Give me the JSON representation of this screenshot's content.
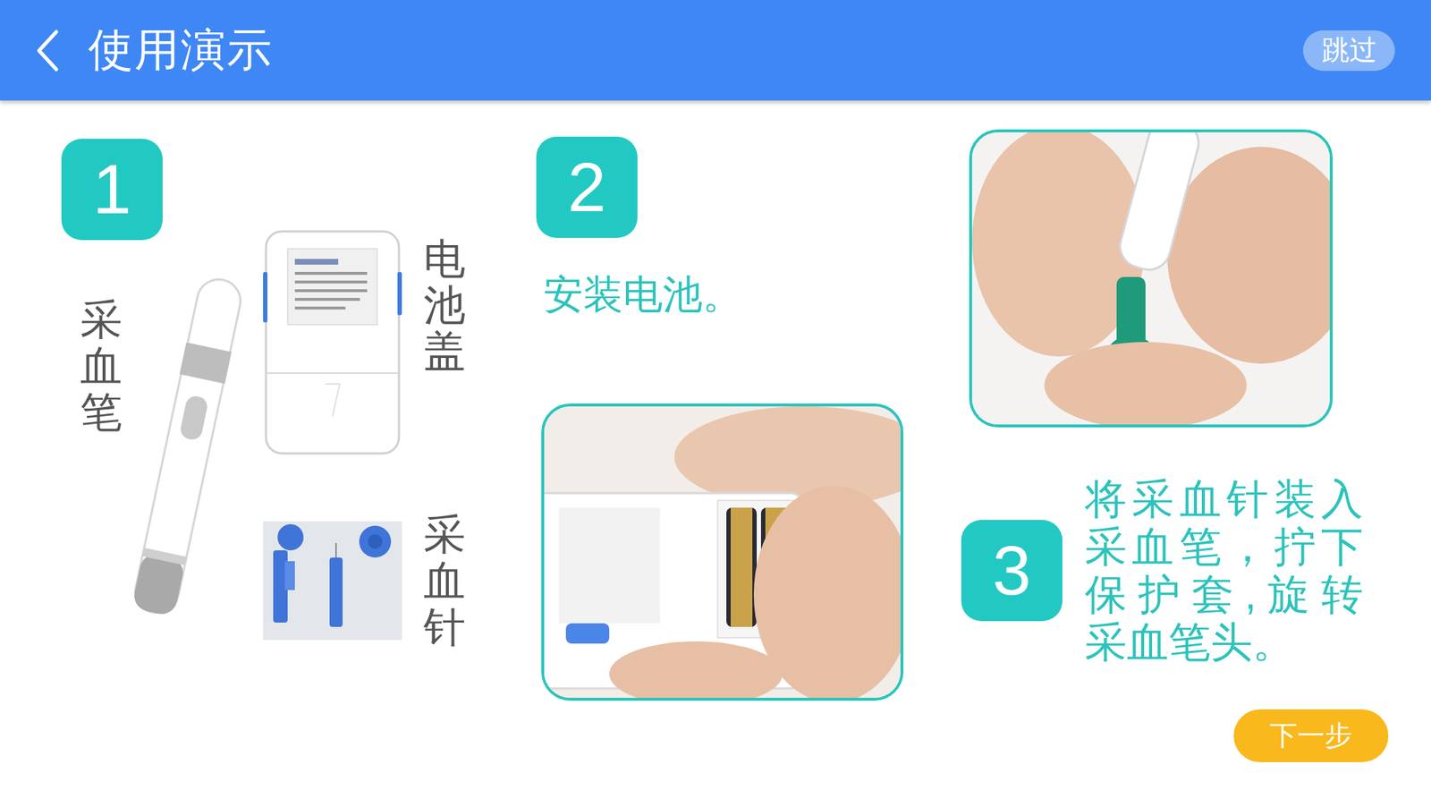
{
  "header": {
    "title": "使用演示",
    "skip_button": "跳过"
  },
  "steps": [
    {
      "number": "1",
      "items": [
        {
          "label": "采血笔"
        },
        {
          "label": "电池盖"
        },
        {
          "label": "采血针"
        }
      ]
    },
    {
      "number": "2",
      "description": "安装电池。"
    },
    {
      "number": "3",
      "description_lines": [
        "将采血针装入",
        "采血笔，拧下",
        "保护套,旋转",
        "采血笔头。"
      ]
    }
  ],
  "next_button": "下一步"
}
